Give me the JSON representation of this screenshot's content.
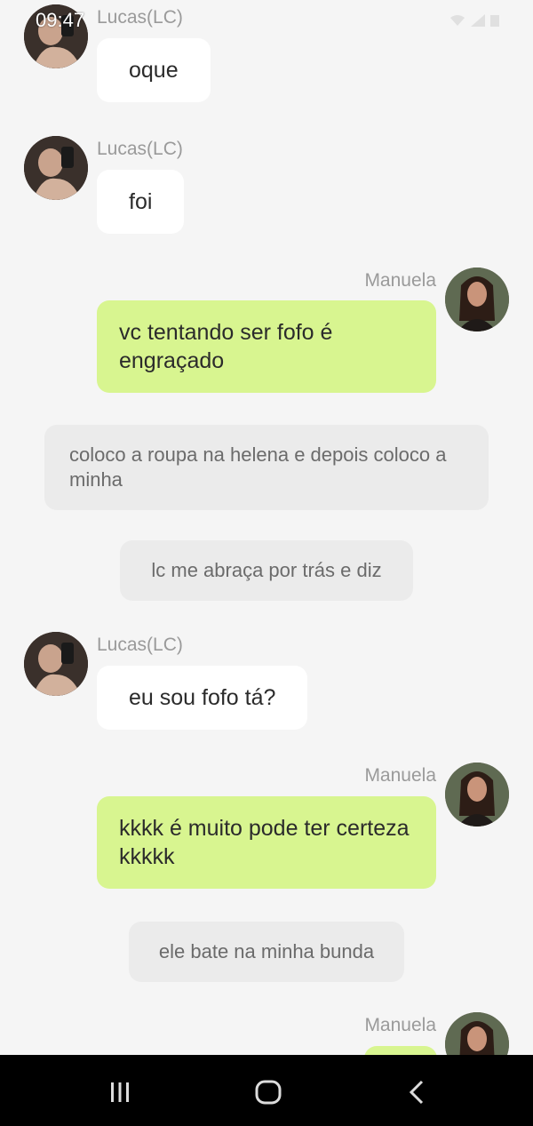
{
  "status_bar": {
    "time": "09:47"
  },
  "messages": [
    {
      "sender": "Lucas(LC)",
      "text": "oque"
    },
    {
      "sender": "Lucas(LC)",
      "text": "foi"
    },
    {
      "sender": "Manuela",
      "text": "vc tentando ser fofo é engraçado"
    },
    {
      "system": "coloco a roupa na helena   e depois coloco a minha"
    },
    {
      "system": "lc me abraça por trás e diz"
    },
    {
      "sender": "Lucas(LC)",
      "text": "eu sou fofo tá?"
    },
    {
      "sender": "Manuela",
      "text": "kkkk é muito pode ter certeza kkkkk"
    },
    {
      "system": "ele bate na minha bunda"
    },
    {
      "sender": "Manuela",
      "text": ""
    }
  ],
  "nav": {
    "recents_icon": "recents-icon",
    "home_icon": "home-icon",
    "back_icon": "back-icon"
  },
  "colors": {
    "incoming": "#ffffff",
    "outgoing": "#d8f590",
    "system": "#ebebeb",
    "background": "#f5f5f5"
  }
}
